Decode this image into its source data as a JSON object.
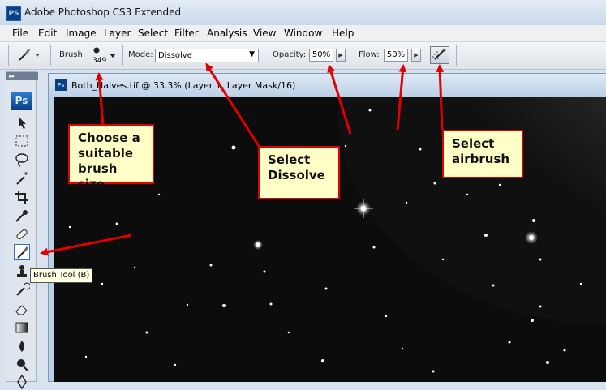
{
  "window": {
    "title": "Adobe Photoshop CS3 Extended",
    "app_icon": "PS"
  },
  "menu": [
    "File",
    "Edit",
    "Image",
    "Layer",
    "Select",
    "Filter",
    "Analysis",
    "View",
    "Window",
    "Help"
  ],
  "options": {
    "brush_label": "Brush:",
    "brush_size": "349",
    "mode_label": "Mode:",
    "mode_value": "Dissolve",
    "opacity_label": "Opacity:",
    "opacity_value": "50%",
    "flow_label": "Flow:",
    "flow_value": "50%"
  },
  "toolbox": {
    "logo": "Ps",
    "tooltip": "Brush Tool (B)",
    "tools": [
      "move-icon",
      "marquee-icon",
      "lasso-icon",
      "magic-wand-icon",
      "crop-icon",
      "eyedropper-icon",
      "healing-brush-icon",
      "brush-icon",
      "clone-stamp-icon",
      "history-brush-icon",
      "eraser-icon",
      "gradient-icon",
      "blur-icon",
      "dodge-icon",
      "pen-icon"
    ]
  },
  "document": {
    "title": "Both_Halves.tif @ 33.3% (Layer 1, Layer Mask/16)"
  },
  "callouts": {
    "brush": "Choose a\nsuitable\nbrush size",
    "dissolve": "Select\nDissolve",
    "airbrush": "Select\nairbrush"
  },
  "colors": {
    "callout_border": "#e10000",
    "callout_fill": "#ffffc8",
    "arrow": "#e10000"
  }
}
